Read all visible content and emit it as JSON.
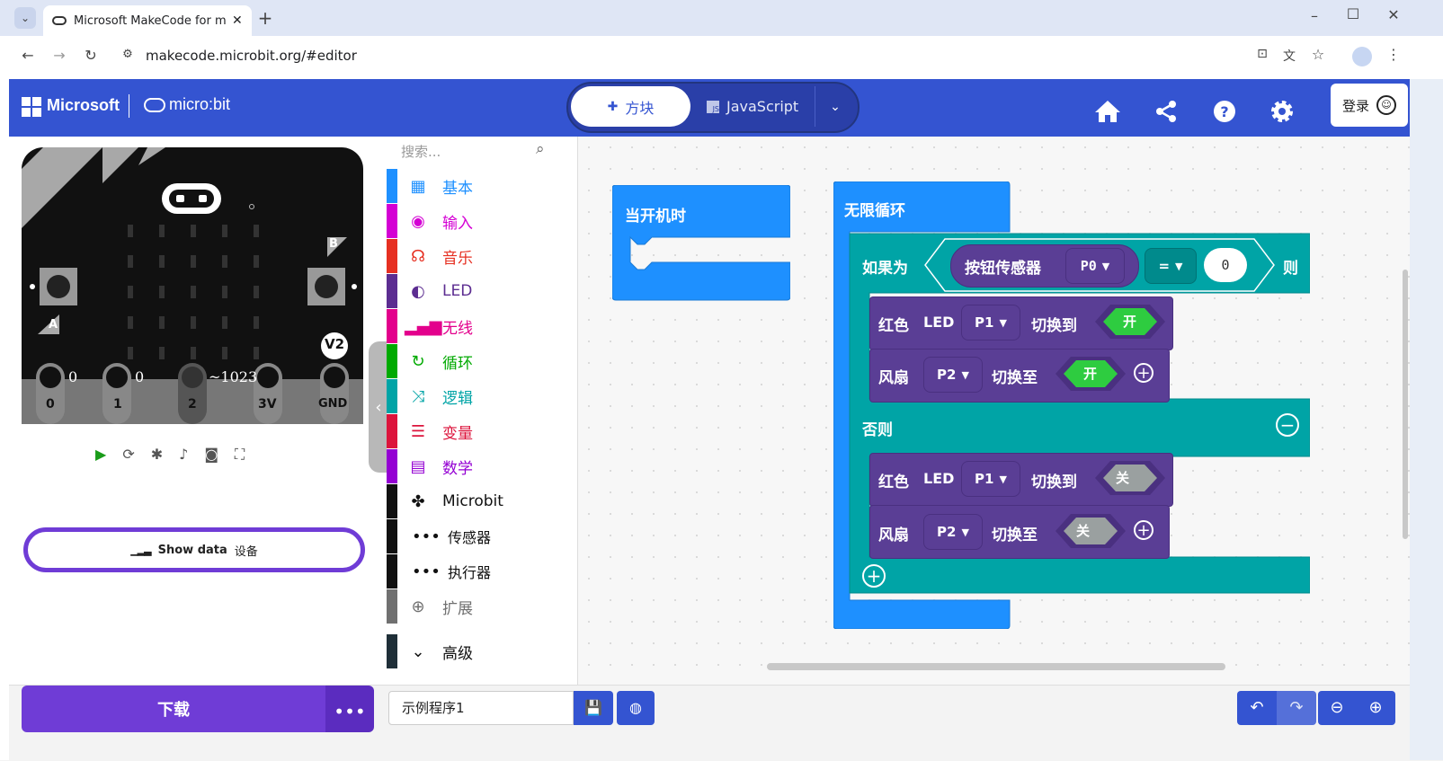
{
  "browser": {
    "tab_title": "Microsoft MakeCode for mic",
    "url": "makecode.microbit.org/#editor"
  },
  "header": {
    "microsoft_label": "Microsoft",
    "microbit_label": "micro:bit",
    "blocks_tab": "方块",
    "javascript_tab": "JavaScript",
    "login_label": "登录"
  },
  "simulator": {
    "pin_labels": [
      "0",
      "1",
      "2",
      "3V",
      "GND"
    ],
    "pin_values": [
      "0",
      "0",
      "~1023"
    ],
    "button_a": "A",
    "button_b": "B",
    "version_badge": "V2",
    "show_data_label": "Show data",
    "show_data_sub": "设备"
  },
  "toolbox": {
    "search_placeholder": "搜索...",
    "categories": [
      {
        "label": "基本",
        "color": "#1e90ff",
        "icon": "grid-icon"
      },
      {
        "label": "输入",
        "color": "#d400d4",
        "icon": "target-icon"
      },
      {
        "label": "音乐",
        "color": "#e63022",
        "icon": "headphones-icon"
      },
      {
        "label": "LED",
        "color": "#5c2d91",
        "icon": "toggle-icon"
      },
      {
        "label": "无线",
        "color": "#e3008c",
        "icon": "signal-icon"
      },
      {
        "label": "循环",
        "color": "#00aa00",
        "icon": "refresh-icon"
      },
      {
        "label": "逻辑",
        "color": "#00a4a6",
        "icon": "shuffle-icon"
      },
      {
        "label": "变量",
        "color": "#dc143c",
        "icon": "list-icon"
      },
      {
        "label": "数学",
        "color": "#9400d3",
        "icon": "calculator-icon"
      },
      {
        "label": "Microbit",
        "color": "#000000",
        "icon": "puzzle-icon"
      },
      {
        "label": "传感器",
        "color": "#000000",
        "icon": "dots-icon"
      },
      {
        "label": "执行器",
        "color": "#000000",
        "icon": "dots-icon"
      },
      {
        "label": "扩展",
        "color": "#707070",
        "icon": "plus-circle-icon"
      },
      {
        "label": "高级",
        "color": "#1f2f38",
        "icon": "chevron-down-icon"
      }
    ]
  },
  "blocks": {
    "on_start": "当开机时",
    "forever": "无限循环",
    "if_label": "如果为",
    "sensor_label": "按钮传感器",
    "sensor_pin": "P0",
    "operator": "=",
    "compare_value": "0",
    "then_label": "则",
    "else_label": "否则",
    "red_led_1": "红色",
    "led_word": "LED",
    "led_pin": "P1",
    "switch_to": "切换到",
    "fan_label": "风扇",
    "fan_pin": "P2",
    "switch_to_2": "切换至",
    "on_value": "开",
    "off_value": "关"
  },
  "bottom": {
    "download_label": "下载",
    "project_name": "示例程序1"
  },
  "colors": {
    "header_blue": "#3454d1",
    "logic_teal": "#00a4a6",
    "loop_blue": "#1e90ff",
    "led_purple": "#5c3d99",
    "download_purple": "#6f3cd6"
  }
}
